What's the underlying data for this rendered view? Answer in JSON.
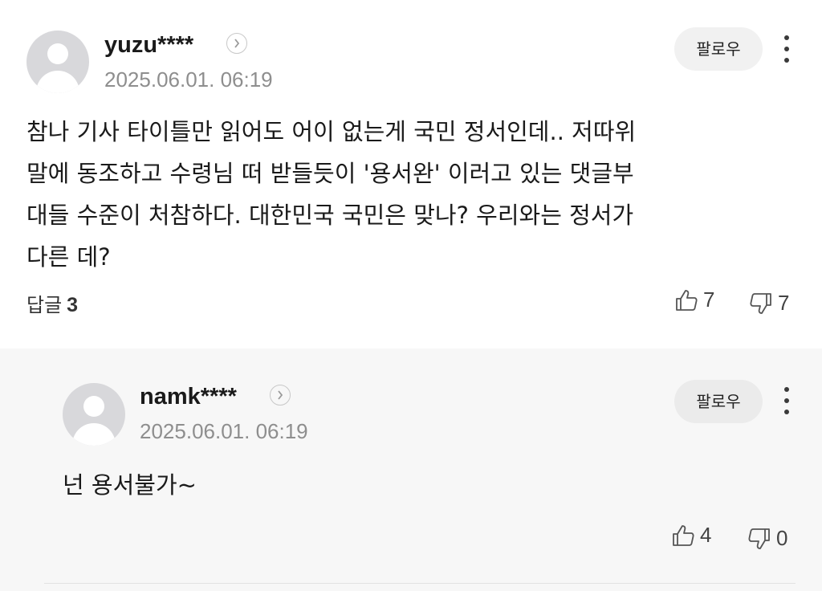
{
  "comments": [
    {
      "username": "yuzu****",
      "timestamp": "2025.06.01. 06:19",
      "follow_label": "팔로우",
      "body": "참나 기사 타이틀만 읽어도 어이 없는게 국민 정서인데.. 저따위 말에 동조하고 수령님 떠 받들듯이 '용서완' 이러고 있는 댓글부대들 수준이 처참하다. 대한민국 국민은 맞나? 우리와는 정서가 다른 데?",
      "body_lines": [
        "참나 기사 타이틀만 읽어도 어이 없는게 국민 정서인데.. 저따위",
        "말에 동조하고 수령님 떠 받들듯이 '용서완' 이러고 있는 댓글부",
        "대들 수준이 처참하다. 대한민국 국민은 맞나? 우리와는 정서가",
        "다른 데?"
      ],
      "reply_label": "답글",
      "reply_count": "3",
      "likes": "7",
      "dislikes": "7"
    },
    {
      "username": "namk****",
      "timestamp": "2025.06.01. 06:19",
      "follow_label": "팔로우",
      "body": "넌 용서불가~",
      "likes": "4",
      "dislikes": "0"
    }
  ],
  "icons": {
    "avatar": "default-avatar-icon",
    "chevron": "chevron-right-icon",
    "more": "more-vertical-icon",
    "like": "thumbs-up-icon",
    "dislike": "thumbs-down-icon"
  },
  "colors": {
    "background": "#ffffff",
    "reply_background": "#f7f7f7",
    "timestamp": "#8e8e8e",
    "follow_button_bg": "#f1f1f1",
    "avatar_bg": "#d8d8db"
  }
}
